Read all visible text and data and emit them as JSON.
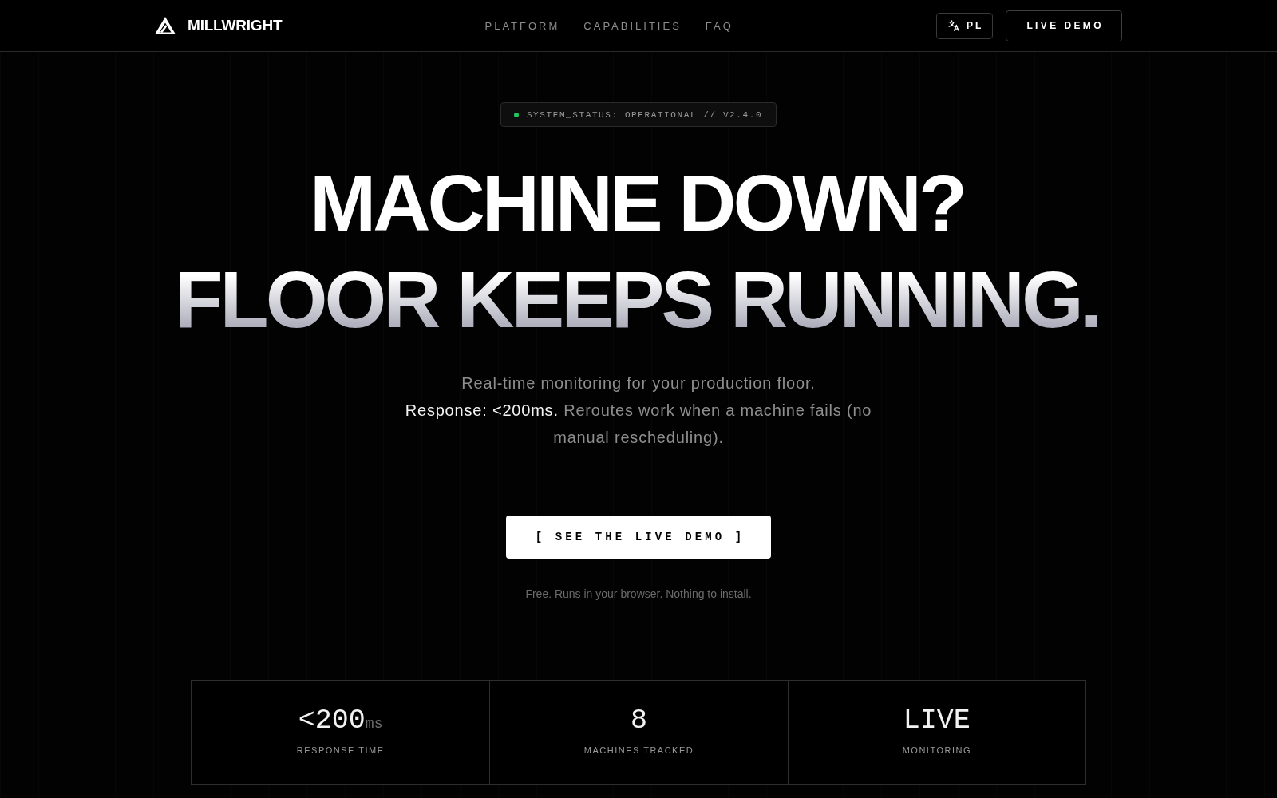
{
  "header": {
    "logo": "MILLWRIGHT",
    "nav": [
      "PLATFORM",
      "CAPABILITIES",
      "FAQ"
    ],
    "language_button": "PL",
    "demo_button": "LIVE DEMO"
  },
  "hero": {
    "status_badge": {
      "text": "SYSTEM_STATUS: OPERATIONAL // V2.4.0",
      "live": true
    },
    "headline": [
      {
        "text": "MACHINE DOWN?",
        "kind": "solid"
      },
      {
        "text": "FLOOR KEEPS RUNNING.",
        "kind": "gradient"
      }
    ],
    "subtitle": [
      "Real-time monitoring for your production floor.",
      "**Response: <200ms.** Reroutes work when a machine fails (no manual rescheduling)."
    ],
    "cta_button": "[ SEE THE LIVE DEMO ]",
    "note": "Free. Runs in your browser. Nothing to install."
  },
  "stats": [
    {
      "value": "<200",
      "unit": "ms",
      "label": "RESPONSE TIME"
    },
    {
      "value": "8",
      "label": "MACHINES TRACKED"
    },
    {
      "value": "LIVE",
      "label": "MONITORING"
    }
  ]
}
